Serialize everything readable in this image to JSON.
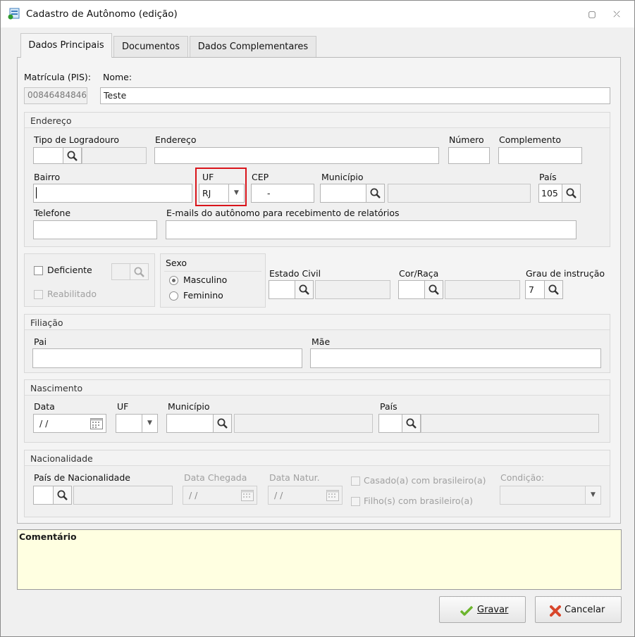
{
  "window": {
    "title": "Cadastro de Autônomo (edição)",
    "restore_glyph": "▢",
    "close_glyph": "⤫"
  },
  "tabs": [
    "Dados Principais",
    "Documentos",
    "Dados Complementares"
  ],
  "main": {
    "matricula_label": "Matrícula (PIS):",
    "matricula_value": "00846484846",
    "nome_label": "Nome:",
    "nome_value": "Teste"
  },
  "endereco": {
    "title": "Endereço",
    "tipo_logradouro_label": "Tipo de Logradouro",
    "tipo_logradouro_value": "",
    "endereco_label": "Endereço",
    "endereco_value": "",
    "numero_label": "Número",
    "numero_value": "",
    "complemento_label": "Complemento",
    "complemento_value": "",
    "bairro_label": "Bairro",
    "bairro_value": "",
    "uf_label": "UF",
    "uf_value": "RJ",
    "cep_label": "CEP",
    "cep_value": "-",
    "municipio_label": "Município",
    "municipio_value": "",
    "pais_label": "País",
    "pais_value": "105",
    "telefone_label": "Telefone",
    "telefone_value": "",
    "emails_label": "E-mails do autônomo para recebimento de relatórios",
    "emails_value": ""
  },
  "pessoais": {
    "deficiente_label": "Deficiente",
    "reabilitado_label": "Reabilitado",
    "sexo_title": "Sexo",
    "masculino_label": "Masculino",
    "feminino_label": "Feminino",
    "sexo_selected": "Masculino",
    "estado_civil_label": "Estado Civil",
    "cor_raca_label": "Cor/Raça",
    "grau_instrucao_label": "Grau de instrução",
    "grau_instrucao_value": "7"
  },
  "filiacao": {
    "title": "Filiação",
    "pai_label": "Pai",
    "pai_value": "",
    "mae_label": "Mãe",
    "mae_value": ""
  },
  "nascimento": {
    "title": "Nascimento",
    "data_label": "Data",
    "data_value": " /  /",
    "uf_label": "UF",
    "municipio_label": "Município",
    "pais_label": "País"
  },
  "nacionalidade": {
    "title": "Nacionalidade",
    "pais_label": "País de Nacionalidade",
    "data_chegada_label": "Data Chegada",
    "data_chegada_value": " /  /",
    "data_natur_label": "Data Natur.",
    "data_natur_value": " /  /",
    "casado_label": "Casado(a) com brasileiro(a)",
    "filhos_label": "Filho(s) com brasileiro(a)",
    "condicao_label": "Condição:"
  },
  "comentario": {
    "title": "Comentário",
    "value": ""
  },
  "buttons": {
    "gravar": "Gravar",
    "cancelar": "Cancelar"
  },
  "colors": {
    "highlight": "#d9141b",
    "comment_bg": "#ffffe1",
    "check_green": "#6cb52d",
    "cancel_red": "#d8462b"
  },
  "icons": [
    "app-icon",
    "search-icon",
    "calendar-icon",
    "chevron-down-icon",
    "check-icon",
    "x-icon"
  ]
}
